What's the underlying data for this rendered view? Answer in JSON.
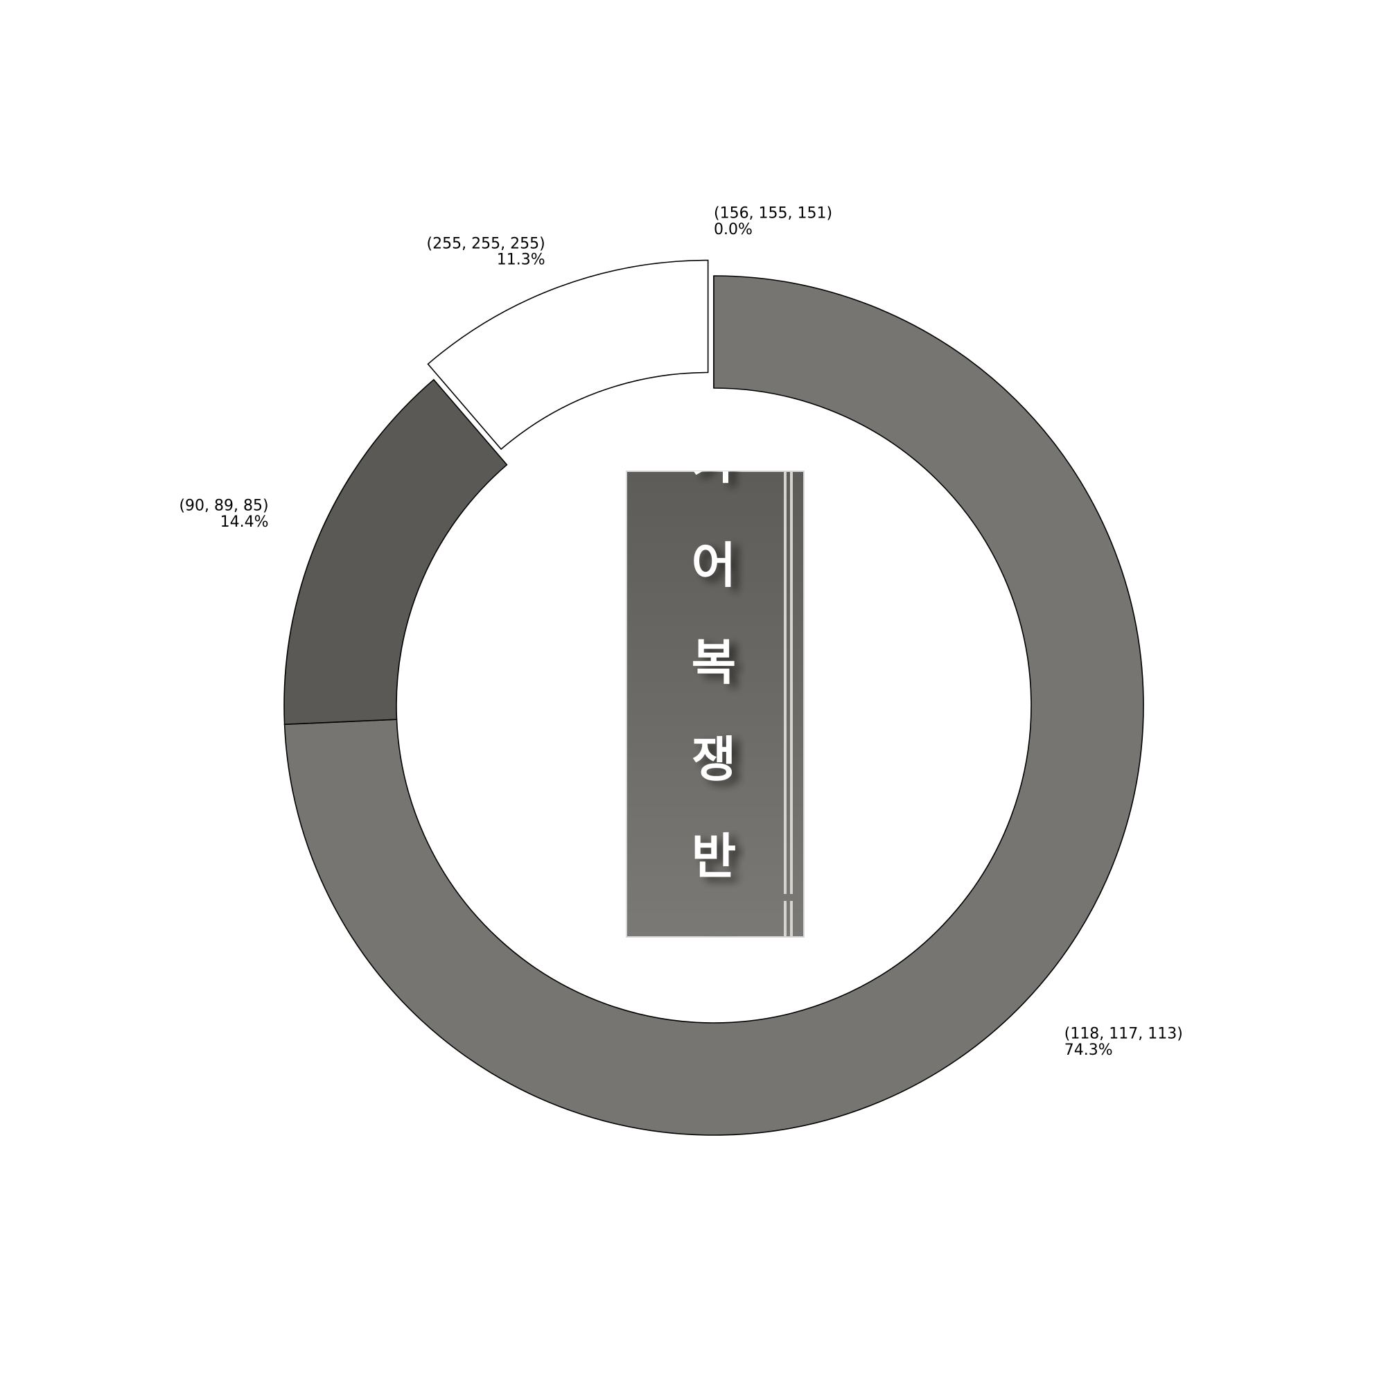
{
  "chart_data": {
    "type": "pie",
    "style": "donut",
    "start": "top, clockwise",
    "slices": [
      {
        "label": "(156, 155, 151)",
        "percent_text": "0.0%",
        "value": 0.0,
        "color": "#9c9b97",
        "exploded": false
      },
      {
        "label": "(118, 117, 113)",
        "percent_text": "74.3%",
        "value": 74.3,
        "color": "#767571",
        "exploded": false
      },
      {
        "label": "(90, 89, 85)",
        "percent_text": "14.4%",
        "value": 14.4,
        "color": "#5a5955",
        "exploded": false
      },
      {
        "label": "(255, 255, 255)",
        "percent_text": "11.3%",
        "value": 11.3,
        "color": "#ffffff",
        "exploded": true
      }
    ],
    "center_image": {
      "description": "photo of vertical Korean signage on a gray background",
      "text_chars": [
        "어",
        "복",
        "쟁",
        "반"
      ]
    }
  }
}
